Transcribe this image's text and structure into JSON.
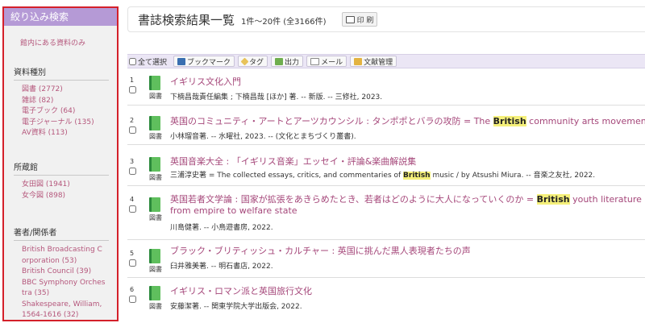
{
  "sidebar": {
    "header": "絞り込み検索",
    "in_library_only": "館内にある資料のみ",
    "facets": [
      {
        "title": "資料種別",
        "items": [
          "図書 (2772)",
          "雑誌 (82)",
          "電子ブック (64)",
          "電子ジャーナル (135)",
          "AV資料 (113)"
        ]
      },
      {
        "title": "所蔵館",
        "items": [
          "女田図 (1941)",
          "女今図 (898)"
        ]
      },
      {
        "title": "著者/関係者",
        "items": [
          "British Broadcasting C",
          "orporation (53)",
          "British Council (39)",
          "BBC Symphony Orches",
          "tra (35)",
          "Shakespeare, William,",
          "1564-1616 (32)"
        ]
      }
    ]
  },
  "header": {
    "title": "書誌検索結果一覧",
    "count": "1件〜20件 (全3166件)",
    "print_label": "印 刷"
  },
  "toolbar": {
    "select_all": "全て選択",
    "bookmark": "ブックマーク",
    "tag": "タグ",
    "output": "出力",
    "mail": "メール",
    "reference_manager": "文献管理"
  },
  "results": [
    {
      "num": "1",
      "type": "図書",
      "title_pre": "イギリス文化入門",
      "title_hl": "",
      "title_post": "",
      "title_line2": "",
      "desc_pre": "下楠昌哉責任編集 ; 下楠昌哉 [ほか] 著. -- 新版. -- 三修社, 2023.",
      "desc_hl": "",
      "desc_post": ""
    },
    {
      "num": "2",
      "type": "図書",
      "title_pre": "英国のコミュニティ・アートとアーツカウンシル : タンポポとバラの攻防 = The ",
      "title_hl": "British",
      "title_post": " community arts movement",
      "title_line2": "",
      "desc_pre": "小林瑠音著. -- 水曜社, 2023. -- (文化とまちづくり叢書).",
      "desc_hl": "",
      "desc_post": ""
    },
    {
      "num": "3",
      "type": "図書",
      "title_pre": "英国音楽大全 : 「イギリス音楽」エッセイ・評論&楽曲解説集",
      "title_hl": "",
      "title_post": "",
      "title_line2": "",
      "desc_pre": "三浦淳史著 = The collected essays, critics, and commentaries of ",
      "desc_hl": "British",
      "desc_post": " music / by Atsushi Miura. -- 音楽之友社, 2022."
    },
    {
      "num": "4",
      "type": "図書",
      "title_pre": "英国若者文学論 : 国家が拡張をあきらめたとき、若者はどのように大人になっていくのか = ",
      "title_hl": "British",
      "title_post": " youth literature :",
      "title_line2": "from empire to welfare state",
      "desc_pre": "川島健著. -- 小鳥遊書房, 2022.",
      "desc_hl": "",
      "desc_post": ""
    },
    {
      "num": "5",
      "type": "図書",
      "title_pre": "ブラック・ブリティッシュ・カルチャー : 英国に挑んだ黒人表現者たちの声",
      "title_hl": "",
      "title_post": "",
      "title_line2": "",
      "desc_pre": "臼井雅美著. -- 明石書店, 2022.",
      "desc_hl": "",
      "desc_post": ""
    },
    {
      "num": "6",
      "type": "図書",
      "title_pre": "イギリス・ロマン派と英国旅行文化",
      "title_hl": "",
      "title_post": "",
      "title_line2": "",
      "desc_pre": "安藤潔著. -- 関東学院大学出版会, 2022.",
      "desc_hl": "",
      "desc_post": ""
    }
  ]
}
